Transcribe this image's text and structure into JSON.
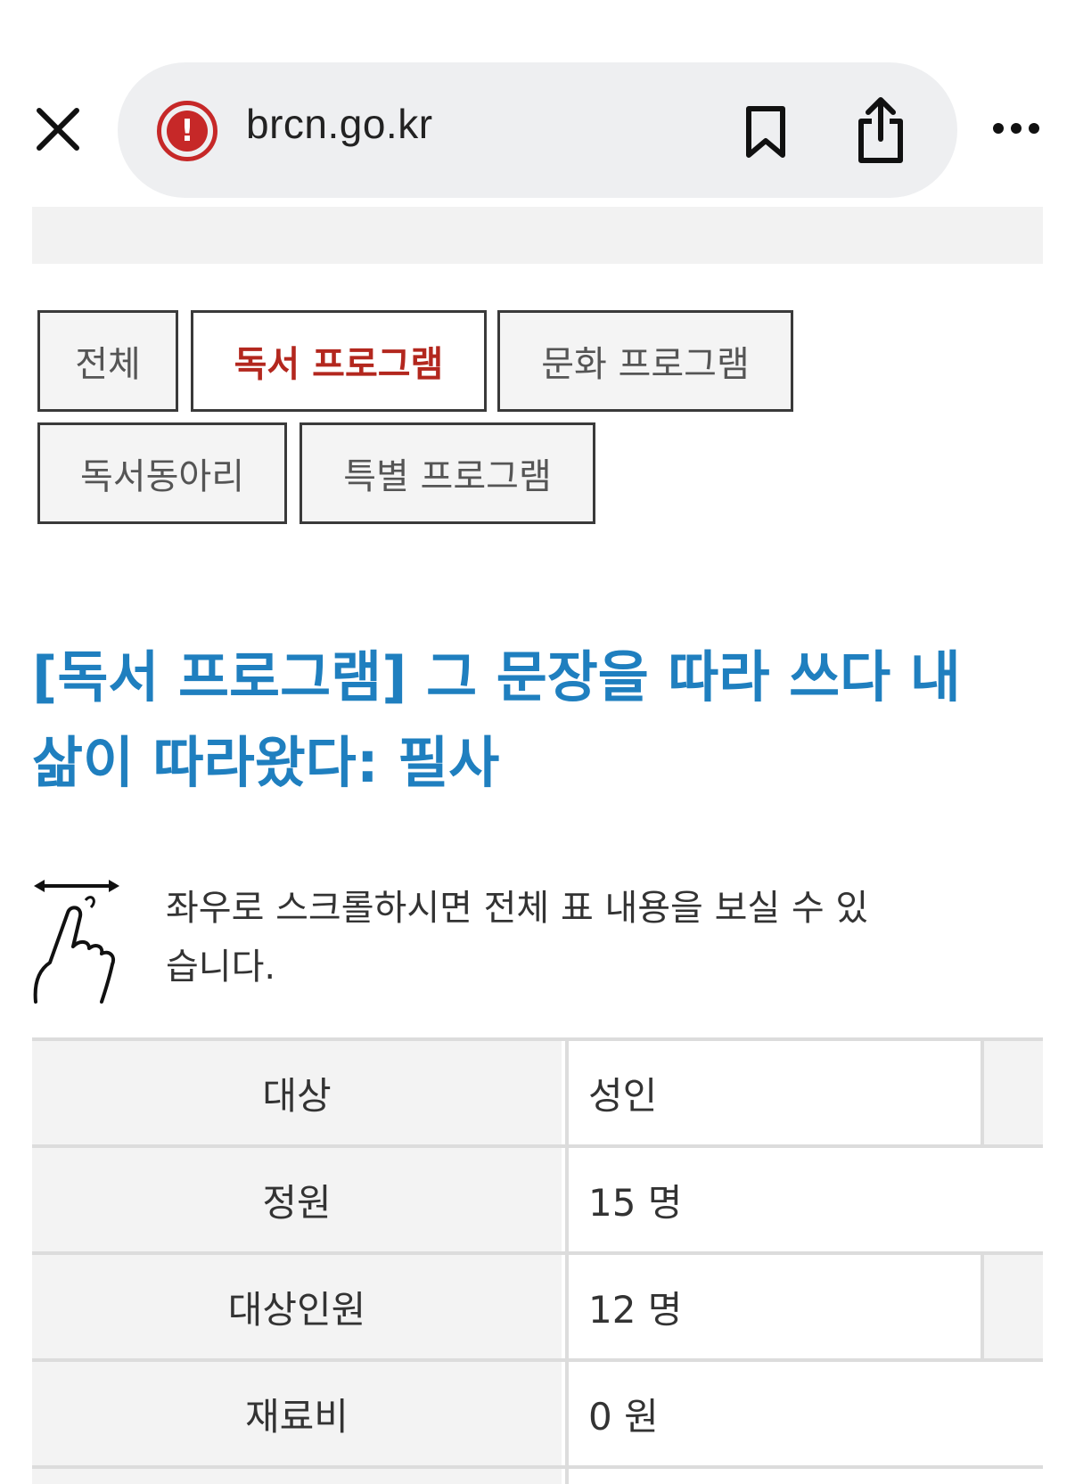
{
  "browser": {
    "url": "brcn.go.kr"
  },
  "strip": {
    "text": ""
  },
  "tabs": [
    {
      "label": "전체",
      "active": false
    },
    {
      "label": "독서 프로그램",
      "active": true
    },
    {
      "label": "문화 프로그램",
      "active": false
    },
    {
      "label": "독서동아리",
      "active": false
    },
    {
      "label": "특별 프로그램",
      "active": false
    }
  ],
  "program": {
    "title": "[독서 프로그램] 그 문장을 따라 쓰다 내 삶이 따라왔다: 필사"
  },
  "scroll_hint": {
    "text": "좌우로 스크롤하시면 전체 표 내용을 보실 수 있습니다."
  },
  "table": {
    "rows": [
      {
        "label": "대상",
        "value": "성인"
      },
      {
        "label": "정원",
        "value": "15 명"
      },
      {
        "label": "대상인원",
        "value": "12 명"
      },
      {
        "label": "재료비",
        "value": "0 원"
      }
    ]
  },
  "colors": {
    "accent_red": "#b3271e",
    "title_blue": "#1f7fbf",
    "warning_red": "#c62828"
  }
}
